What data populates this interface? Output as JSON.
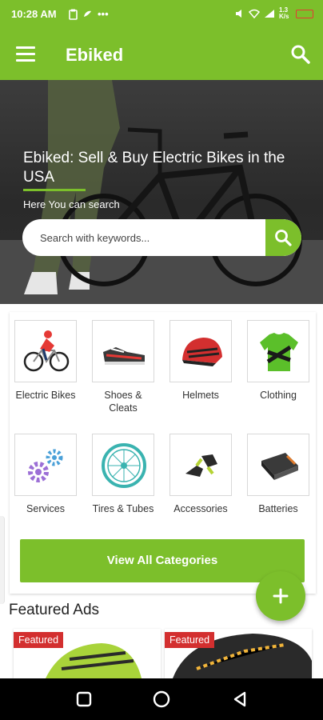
{
  "status_bar": {
    "time": "10:28 AM",
    "dots": "•••",
    "network_speed": "1.3 K/s"
  },
  "app_bar": {
    "title": "Ebiked"
  },
  "hero": {
    "title": "Ebiked: Sell & Buy Electric Bikes in the USA",
    "subtitle": "Here You can search",
    "search_placeholder": "Search with keywords..."
  },
  "categories": {
    "items": [
      {
        "label": "Electric Bikes",
        "icon": "electric-bike-icon"
      },
      {
        "label": "Shoes & Cleats",
        "icon": "shoe-icon"
      },
      {
        "label": "Helmets",
        "icon": "helmet-icon"
      },
      {
        "label": "Clothing",
        "icon": "jersey-icon"
      },
      {
        "label": "Services",
        "icon": "gears-icon"
      },
      {
        "label": "Tires & Tubes",
        "icon": "tire-icon"
      },
      {
        "label": "Accessories",
        "icon": "bike-accessory-icon"
      },
      {
        "label": "Batteries",
        "icon": "battery-icon"
      }
    ],
    "view_all_label": "View All Categories"
  },
  "featured": {
    "title": "Featured Ads",
    "ads": [
      {
        "badge": "Featured"
      },
      {
        "badge": "Featured"
      }
    ]
  },
  "colors": {
    "accent": "#7cbf2b",
    "badge": "#d32f2f"
  }
}
